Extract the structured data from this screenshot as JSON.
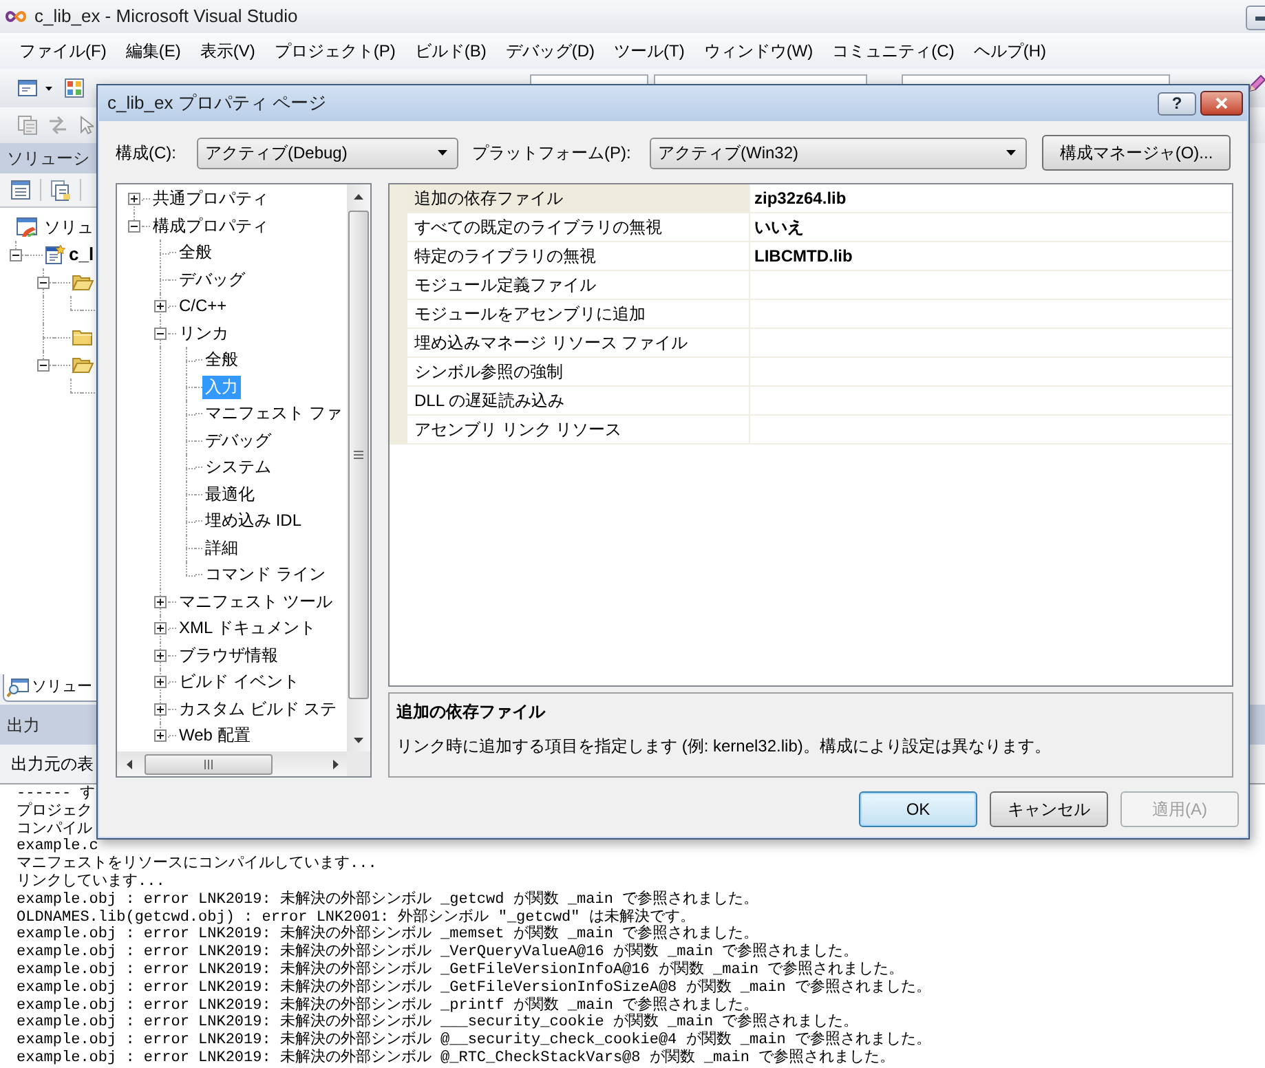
{
  "window": {
    "title": "c_lib_ex - Microsoft Visual Studio"
  },
  "menu": [
    "ファイル(F)",
    "編集(E)",
    "表示(V)",
    "プロジェクト(P)",
    "ビルド(B)",
    "デバッグ(D)",
    "ツール(T)",
    "ウィンドウ(W)",
    "コミュニティ(C)",
    "ヘルプ(H)"
  ],
  "solution_explorer": {
    "title": "ソリューシ",
    "tree": [
      {
        "kind": "solution",
        "label": "ソリュ",
        "children": [
          {
            "kind": "project",
            "label": "c_l",
            "expanded": true,
            "children": [
              {
                "kind": "folder",
                "expanded": true,
                "children": [
                  {
                    "kind": "item"
                  }
                ]
              },
              {
                "kind": "folder",
                "expanded": false
              },
              {
                "kind": "folder",
                "expanded": true,
                "children": [
                  {
                    "kind": "item"
                  }
                ]
              }
            ]
          }
        ]
      }
    ],
    "tab": "ソリュー"
  },
  "output": {
    "title": "出力",
    "source_label": "出力元の表",
    "lines": [
      "------ す",
      "プロジェク",
      "コンパイル",
      "example.c",
      "マニフェストをリソースにコンパイルしています...",
      "リンクしています...",
      "example.obj : error LNK2019: 未解決の外部シンボル _getcwd が関数 _main で参照されました。",
      "OLDNAMES.lib(getcwd.obj) : error LNK2001: 外部シンボル \"_getcwd\" は未解決です。",
      "example.obj : error LNK2019: 未解決の外部シンボル _memset が関数 _main で参照されました。",
      "example.obj : error LNK2019: 未解決の外部シンボル _VerQueryValueA@16 が関数 _main で参照されました。",
      "example.obj : error LNK2019: 未解決の外部シンボル _GetFileVersionInfoA@16 が関数 _main で参照されました。",
      "example.obj : error LNK2019: 未解決の外部シンボル _GetFileVersionInfoSizeA@8 が関数 _main で参照されました。",
      "example.obj : error LNK2019: 未解決の外部シンボル _printf が関数 _main で参照されました。",
      "example.obj : error LNK2019: 未解決の外部シンボル ___security_cookie が関数 _main で参照されました。",
      "example.obj : error LNK2019: 未解決の外部シンボル @__security_check_cookie@4 が関数 _main で参照されました。",
      "example.obj : error LNK2019: 未解決の外部シンボル @_RTC_CheckStackVars@8 が関数 _main で参照されました。"
    ]
  },
  "dialog": {
    "title": "c_lib_ex プロパティ ページ",
    "help_button": "?",
    "configuration": {
      "label": "構成(C):",
      "value": "アクティブ(Debug)"
    },
    "platform": {
      "label": "プラットフォーム(P):",
      "value": "アクティブ(Win32)"
    },
    "manager_button": "構成マネージャ(O)...",
    "tree": [
      {
        "label": "共通プロパティ",
        "expanded": false,
        "selected": false
      },
      {
        "label": "構成プロパティ",
        "expanded": true,
        "selected": false,
        "children": [
          {
            "label": "全般",
            "selected": false
          },
          {
            "label": "デバッグ",
            "selected": false
          },
          {
            "label": "C/C++",
            "expanded": false,
            "selected": false
          },
          {
            "label": "リンカ",
            "expanded": true,
            "selected": false,
            "children": [
              {
                "label": "全般",
                "selected": false
              },
              {
                "label": "入力",
                "selected": true
              },
              {
                "label": "マニフェスト ファ",
                "selected": false
              },
              {
                "label": "デバッグ",
                "selected": false
              },
              {
                "label": "システム",
                "selected": false
              },
              {
                "label": "最適化",
                "selected": false
              },
              {
                "label": "埋め込み IDL",
                "selected": false
              },
              {
                "label": "詳細",
                "selected": false
              },
              {
                "label": "コマンド ライン",
                "selected": false
              }
            ]
          },
          {
            "label": "マニフェスト ツール",
            "expanded": false,
            "selected": false
          },
          {
            "label": "XML ドキュメント",
            "expanded": false,
            "selected": false
          },
          {
            "label": "ブラウザ情報",
            "expanded": false,
            "selected": false
          },
          {
            "label": "ビルド イベント",
            "expanded": false,
            "selected": false
          },
          {
            "label": "カスタム ビルド ステ",
            "expanded": false,
            "selected": false
          },
          {
            "label": "Web 配置",
            "expanded": false,
            "selected": false
          }
        ]
      }
    ],
    "properties": [
      {
        "name": "追加の依存ファイル",
        "value": "zip32z64.lib",
        "selected": true
      },
      {
        "name": "すべての既定のライブラリの無視",
        "value": "いいえ",
        "selected": false
      },
      {
        "name": "特定のライブラリの無視",
        "value": "LIBCMTD.lib",
        "selected": false
      },
      {
        "name": "モジュール定義ファイル",
        "selected": false
      },
      {
        "name": "モジュールをアセンブリに追加",
        "selected": false
      },
      {
        "name": "埋め込みマネージ リソース ファイル",
        "selected": false
      },
      {
        "name": "シンボル参照の強制",
        "selected": false
      },
      {
        "name": "DLL の遅延読み込み",
        "selected": false
      },
      {
        "name": "アセンブリ リンク リソース",
        "selected": false
      }
    ],
    "description": {
      "title": "追加の依存ファイル",
      "text": "リンク時に追加する項目を指定します (例: kernel32.lib)。構成により設定は異なります。"
    },
    "buttons": [
      {
        "label": "OK",
        "default": true,
        "disabled": false
      },
      {
        "label": "キャンセル",
        "default": false,
        "disabled": false
      },
      {
        "label": "適用(A)",
        "default": false,
        "disabled": true
      }
    ]
  }
}
